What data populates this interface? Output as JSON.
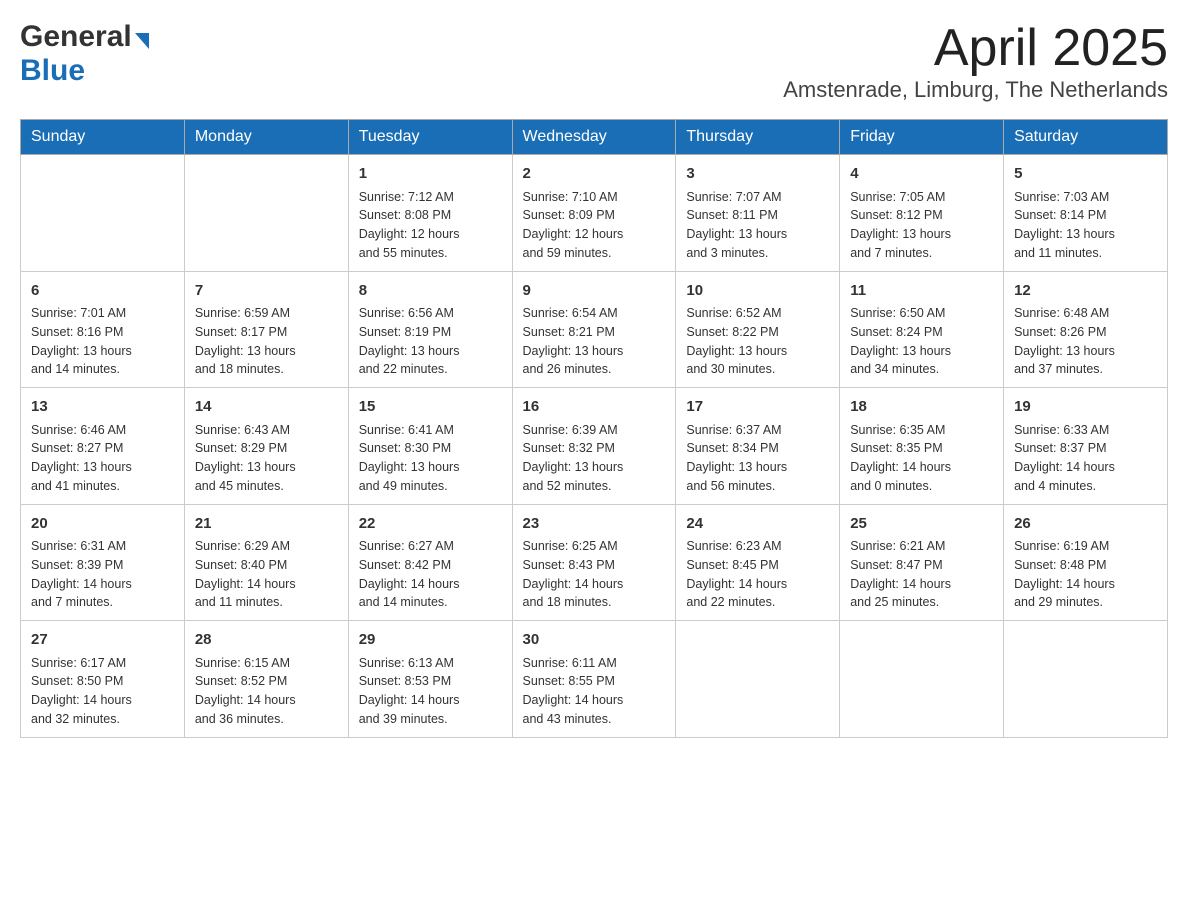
{
  "header": {
    "month_title": "April 2025",
    "location": "Amstenrade, Limburg, The Netherlands",
    "logo_general": "General",
    "logo_blue": "Blue"
  },
  "days_of_week": [
    "Sunday",
    "Monday",
    "Tuesday",
    "Wednesday",
    "Thursday",
    "Friday",
    "Saturday"
  ],
  "weeks": [
    [
      {
        "day": "",
        "info": ""
      },
      {
        "day": "",
        "info": ""
      },
      {
        "day": "1",
        "info": "Sunrise: 7:12 AM\nSunset: 8:08 PM\nDaylight: 12 hours\nand 55 minutes."
      },
      {
        "day": "2",
        "info": "Sunrise: 7:10 AM\nSunset: 8:09 PM\nDaylight: 12 hours\nand 59 minutes."
      },
      {
        "day": "3",
        "info": "Sunrise: 7:07 AM\nSunset: 8:11 PM\nDaylight: 13 hours\nand 3 minutes."
      },
      {
        "day": "4",
        "info": "Sunrise: 7:05 AM\nSunset: 8:12 PM\nDaylight: 13 hours\nand 7 minutes."
      },
      {
        "day": "5",
        "info": "Sunrise: 7:03 AM\nSunset: 8:14 PM\nDaylight: 13 hours\nand 11 minutes."
      }
    ],
    [
      {
        "day": "6",
        "info": "Sunrise: 7:01 AM\nSunset: 8:16 PM\nDaylight: 13 hours\nand 14 minutes."
      },
      {
        "day": "7",
        "info": "Sunrise: 6:59 AM\nSunset: 8:17 PM\nDaylight: 13 hours\nand 18 minutes."
      },
      {
        "day": "8",
        "info": "Sunrise: 6:56 AM\nSunset: 8:19 PM\nDaylight: 13 hours\nand 22 minutes."
      },
      {
        "day": "9",
        "info": "Sunrise: 6:54 AM\nSunset: 8:21 PM\nDaylight: 13 hours\nand 26 minutes."
      },
      {
        "day": "10",
        "info": "Sunrise: 6:52 AM\nSunset: 8:22 PM\nDaylight: 13 hours\nand 30 minutes."
      },
      {
        "day": "11",
        "info": "Sunrise: 6:50 AM\nSunset: 8:24 PM\nDaylight: 13 hours\nand 34 minutes."
      },
      {
        "day": "12",
        "info": "Sunrise: 6:48 AM\nSunset: 8:26 PM\nDaylight: 13 hours\nand 37 minutes."
      }
    ],
    [
      {
        "day": "13",
        "info": "Sunrise: 6:46 AM\nSunset: 8:27 PM\nDaylight: 13 hours\nand 41 minutes."
      },
      {
        "day": "14",
        "info": "Sunrise: 6:43 AM\nSunset: 8:29 PM\nDaylight: 13 hours\nand 45 minutes."
      },
      {
        "day": "15",
        "info": "Sunrise: 6:41 AM\nSunset: 8:30 PM\nDaylight: 13 hours\nand 49 minutes."
      },
      {
        "day": "16",
        "info": "Sunrise: 6:39 AM\nSunset: 8:32 PM\nDaylight: 13 hours\nand 52 minutes."
      },
      {
        "day": "17",
        "info": "Sunrise: 6:37 AM\nSunset: 8:34 PM\nDaylight: 13 hours\nand 56 minutes."
      },
      {
        "day": "18",
        "info": "Sunrise: 6:35 AM\nSunset: 8:35 PM\nDaylight: 14 hours\nand 0 minutes."
      },
      {
        "day": "19",
        "info": "Sunrise: 6:33 AM\nSunset: 8:37 PM\nDaylight: 14 hours\nand 4 minutes."
      }
    ],
    [
      {
        "day": "20",
        "info": "Sunrise: 6:31 AM\nSunset: 8:39 PM\nDaylight: 14 hours\nand 7 minutes."
      },
      {
        "day": "21",
        "info": "Sunrise: 6:29 AM\nSunset: 8:40 PM\nDaylight: 14 hours\nand 11 minutes."
      },
      {
        "day": "22",
        "info": "Sunrise: 6:27 AM\nSunset: 8:42 PM\nDaylight: 14 hours\nand 14 minutes."
      },
      {
        "day": "23",
        "info": "Sunrise: 6:25 AM\nSunset: 8:43 PM\nDaylight: 14 hours\nand 18 minutes."
      },
      {
        "day": "24",
        "info": "Sunrise: 6:23 AM\nSunset: 8:45 PM\nDaylight: 14 hours\nand 22 minutes."
      },
      {
        "day": "25",
        "info": "Sunrise: 6:21 AM\nSunset: 8:47 PM\nDaylight: 14 hours\nand 25 minutes."
      },
      {
        "day": "26",
        "info": "Sunrise: 6:19 AM\nSunset: 8:48 PM\nDaylight: 14 hours\nand 29 minutes."
      }
    ],
    [
      {
        "day": "27",
        "info": "Sunrise: 6:17 AM\nSunset: 8:50 PM\nDaylight: 14 hours\nand 32 minutes."
      },
      {
        "day": "28",
        "info": "Sunrise: 6:15 AM\nSunset: 8:52 PM\nDaylight: 14 hours\nand 36 minutes."
      },
      {
        "day": "29",
        "info": "Sunrise: 6:13 AM\nSunset: 8:53 PM\nDaylight: 14 hours\nand 39 minutes."
      },
      {
        "day": "30",
        "info": "Sunrise: 6:11 AM\nSunset: 8:55 PM\nDaylight: 14 hours\nand 43 minutes."
      },
      {
        "day": "",
        "info": ""
      },
      {
        "day": "",
        "info": ""
      },
      {
        "day": "",
        "info": ""
      }
    ]
  ]
}
